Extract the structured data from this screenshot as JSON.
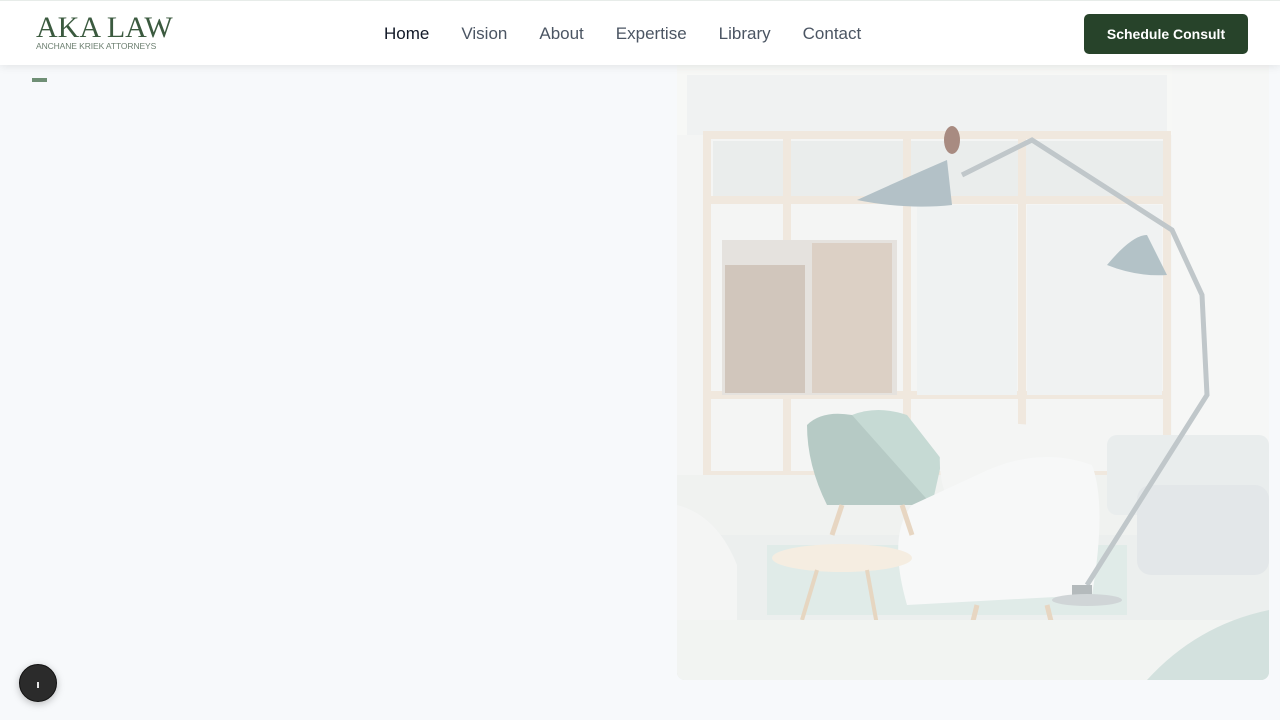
{
  "brand": {
    "logo_text": "AKA LAW",
    "logo_subtext": "ANCHANE KRIEK ATTORNEYS"
  },
  "nav": {
    "items": [
      {
        "label": "Home",
        "active": true
      },
      {
        "label": "Vision",
        "active": false
      },
      {
        "label": "About",
        "active": false
      },
      {
        "label": "Expertise",
        "active": false
      },
      {
        "label": "Library",
        "active": false
      },
      {
        "label": "Contact",
        "active": false
      }
    ]
  },
  "header": {
    "cta_label": "Schedule Consult"
  },
  "colors": {
    "brand_green": "#27432a",
    "accent_green": "#6f8f75",
    "page_bg": "#f7f9fb"
  },
  "hero": {
    "image": "office-lounge-photo"
  },
  "floating": {
    "icon": "accessibility-icon"
  }
}
